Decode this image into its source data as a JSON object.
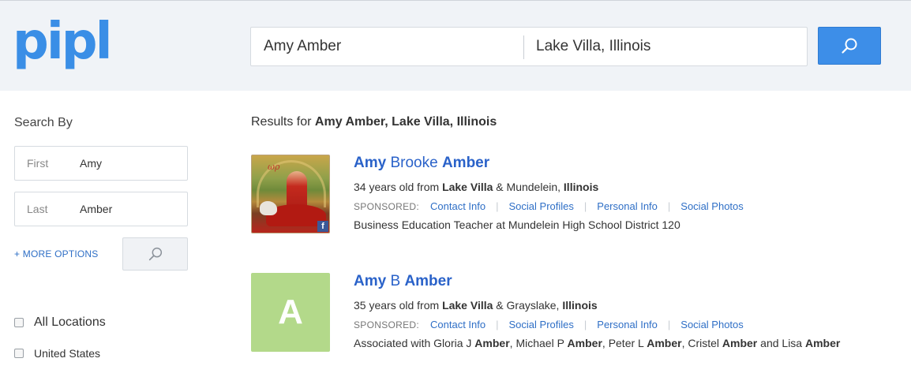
{
  "header": {
    "logo": "pipl",
    "search_name": "Amy Amber",
    "search_location": "Lake Villa, Illinois"
  },
  "sidebar": {
    "title": "Search By",
    "first_label": "First",
    "first_value": "Amy",
    "last_label": "Last",
    "last_value": "Amber",
    "more_options": "+ MORE OPTIONS",
    "locations": [
      {
        "label": "All Locations",
        "checked": false
      },
      {
        "label": "United States",
        "checked": false
      }
    ]
  },
  "results": {
    "prefix": "Results for ",
    "query": "Amy Amber, Lake Villa, Illinois",
    "sponsored_label": "SPONSORED:",
    "sponsored_links": [
      "Contact Info",
      "Social Profiles",
      "Personal Info",
      "Social Photos"
    ],
    "items": [
      {
        "first": "Amy",
        "middle": "Brooke",
        "last": "Amber",
        "avatar": "photo",
        "age_text": "34 years old from",
        "city1": "Lake Villa",
        "joiner": "&",
        "city2": "Mundelein,",
        "state": "Illinois",
        "detail": "Business Education Teacher at Mundelein High School District 120"
      },
      {
        "first": "Amy",
        "middle": "B",
        "last": "Amber",
        "avatar": "A",
        "avatar_color": "#b3d98a",
        "age_text": "35 years old from",
        "city1": "Lake Villa",
        "joiner": "&",
        "city2": "Grayslake,",
        "state": "Illinois",
        "assoc_prefix": "Associated with",
        "assoc": [
          {
            "first": "Gloria J",
            "last": "Amber",
            "sep": ","
          },
          {
            "first": "Michael P",
            "last": "Amber",
            "sep": ","
          },
          {
            "first": "Peter L",
            "last": "Amber",
            "sep": ","
          },
          {
            "first": "Cristel",
            "last": "Amber",
            "sep": " and"
          },
          {
            "first": "Lisa",
            "last": "Amber",
            "sep": ""
          }
        ]
      }
    ]
  }
}
